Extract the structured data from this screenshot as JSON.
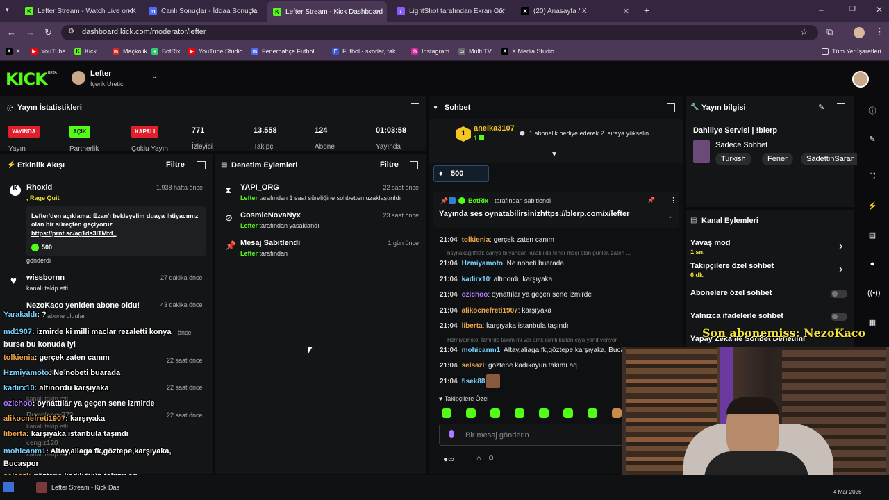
{
  "browser": {
    "tabs": [
      {
        "title": "Lefter Stream - Watch Live on K",
        "icon": "kick-icon",
        "color": "#53fc18",
        "glyph": "K"
      },
      {
        "title": "Canlı Sonuçlar - İddaa Sonuçla",
        "icon": "mackolik-icon",
        "color": "#4a6cf7",
        "glyph": "m"
      },
      {
        "title": "Lefter Stream - Kick Dashboard",
        "icon": "kick-icon",
        "color": "#53fc18",
        "glyph": "K"
      },
      {
        "title": "LightShot tarafından Ekran Gör",
        "icon": "feather-icon",
        "color": "#8a5cf6",
        "glyph": "/"
      },
      {
        "title": "(20) Anasayfa / X",
        "icon": "x-icon",
        "color": "#000000",
        "glyph": "X"
      }
    ],
    "url": "dashboard.kick.com/moderator/lefter",
    "bookmarks": [
      {
        "label": "X",
        "icon": "x-icon",
        "color": "#000000",
        "glyph": "X"
      },
      {
        "label": "YouTube",
        "icon": "youtube-icon",
        "color": "#ff0000",
        "glyph": "▶"
      },
      {
        "label": "Kick",
        "icon": "kick-icon",
        "color": "#53fc18",
        "glyph": "K"
      },
      {
        "label": "Maçkolik",
        "icon": "mackolik-icon",
        "color": "#e2231a",
        "glyph": "m"
      },
      {
        "label": "BotRix",
        "icon": "botrix-icon",
        "color": "#2ecc71",
        "glyph": "●"
      },
      {
        "label": "YouTube Studio",
        "icon": "youtube-studio-icon",
        "color": "#ff0000",
        "glyph": "▶"
      },
      {
        "label": "Fenerbahçe Futbol...",
        "icon": "mackolik-icon",
        "color": "#4a6cf7",
        "glyph": "m"
      },
      {
        "label": "Futbol - skorlar, tak...",
        "icon": "flashscore-icon",
        "color": "#3b5bdb",
        "glyph": "F"
      },
      {
        "label": "Instagram",
        "icon": "instagram-icon",
        "color": "#d6249f",
        "glyph": "◎"
      },
      {
        "label": "Multi TV",
        "icon": "tv-icon",
        "color": "#666666",
        "glyph": "▭"
      },
      {
        "label": "X Media Studio",
        "icon": "x-icon",
        "color": "#000000",
        "glyph": "X"
      }
    ],
    "all_bookmarks": "Tüm Yer İşaretleri"
  },
  "kick": {
    "logo": "KICK",
    "beta": "BETA",
    "user": {
      "name": "Lefter",
      "role": "İçerik Üretici"
    }
  },
  "stats": {
    "title": "Yayın İstatistikleri",
    "statuses": [
      {
        "badge": "YAYINDA",
        "label": "Yayın",
        "bg": "#e0202d",
        "fg": "#ffffff"
      },
      {
        "badge": "AÇIK",
        "label": "Partnerlik",
        "bg": "#53fc18",
        "fg": "#0b0b0d"
      },
      {
        "badge": "KAPALI",
        "label": "Çoklu Yayın",
        "bg": "#e0202d",
        "fg": "#ffffff"
      }
    ],
    "metrics": [
      {
        "value": "771",
        "label": "İzleyici"
      },
      {
        "value": "13.558",
        "label": "Takipçi"
      },
      {
        "value": "124",
        "label": "Abone"
      },
      {
        "value": "01:03:58",
        "label": "Yayında"
      }
    ]
  },
  "activity": {
    "title": "Etkinlik Akışı",
    "filter": "Filtre",
    "items": [
      {
        "user": "Rhoxid",
        "time": "1.938 hafta önce",
        "sub": ", Rage Quit",
        "note": "Lefter'den açıklama: Ezan'ı bekleyelim duaya ihtiyacımız olan bir süreçten geçiyoruz",
        "link": "https://prnt.sc/ag1ds3ITMtd_",
        "amount": "500",
        "action": "gönderdi"
      },
      {
        "user": "wissbornn",
        "time": "27 dakika önce",
        "action": "kanalı takip etti"
      },
      {
        "user": "NezoKaco yeniden abone oldu!",
        "time": "43 dakika önce",
        "action": "abone oldular"
      }
    ],
    "hidden_times": [
      "önce",
      "22 saat önce",
      "22 saat önce",
      "22 saat önce"
    ],
    "hidden_users": [
      "Rumbleboy773",
      "cengiz120"
    ],
    "hidden_actions": [
      "kanalı takip etti",
      "kanalı takip etti",
      "kanalı takip etti",
      "kanalı takip etti"
    ]
  },
  "moderation": {
    "title": "Denetim Eylemleri",
    "filter": "Filtre",
    "items": [
      {
        "user": "YAPI_ORG",
        "time": "22 saat önce",
        "by": "Lefter",
        "desc": " tarafından 1 saat süreliğine sohbetten uzaklaştırıldı",
        "icon": "hourglass-icon"
      },
      {
        "user": "CosmicNovaNyx",
        "time": "23 saat önce",
        "by": "Lefter",
        "desc": " tarafından yasaklandı",
        "icon": "ban-icon"
      },
      {
        "user": "Mesaj Sabitlendi",
        "time": "1 gün önce",
        "by": "Lefter",
        "desc": " tarafından",
        "icon": "pin-icon"
      }
    ]
  },
  "chat": {
    "title": "Sohbet",
    "gift": {
      "user": "anelka3107",
      "rank": "1",
      "count": "1",
      "text": "1 abonelik hediye ederek 2. sıraya yükselin"
    },
    "kicks": "500",
    "pinned": {
      "by": "BotRix",
      "suffix": "tarafından sabitlendi",
      "text": "Yayında ses oynatabilirsiniz.",
      "link": "https://blerp.com/x/lefter"
    },
    "messages": [
      {
        "time": "21:04",
        "user": "tolkienia",
        "color": "#f0a64a",
        "text": "gerçek zaten canım",
        "reply": ""
      },
      {
        "time": "",
        "user": "",
        "color": "",
        "text": "",
        "reply": "hsynakagriffith: sarıyo bi yandan kulaklıkla fener maçı olan günler. zaten ..."
      },
      {
        "time": "21:04",
        "user": "Hzmiyamoto",
        "color": "#7ad1ff",
        "text": "Ne nobeti buarada",
        "reply": ""
      },
      {
        "time": "21:04",
        "user": "kadirx10",
        "color": "#7ad1ff",
        "text": "altınordu karşıyaka",
        "reply": ""
      },
      {
        "time": "21:04",
        "user": "ozichoo",
        "color": "#b07cff",
        "text": "oynattılar ya geçen sene izmirde",
        "reply": ""
      },
      {
        "time": "21:04",
        "user": "alikocnefreti1907",
        "color": "#f0a64a",
        "text": "karşıyaka",
        "reply": ""
      },
      {
        "time": "21:04",
        "user": "liberta",
        "color": "#f0a64a",
        "text": "karşıyaka istanbula taşındı",
        "reply": ""
      },
      {
        "time": "",
        "user": "",
        "color": "",
        "text": "",
        "reply": "Hzmiyamoto: İzmirde takım mi var amk isimli kullanıcıya yanıt veriyor"
      },
      {
        "time": "21:04",
        "user": "mohicanm1",
        "color": "#7ad1ff",
        "text": "Altay,aliaga fk,göztepe,karşıyaka, Buca",
        "reply": ""
      },
      {
        "time": "21:04",
        "user": "selsazi",
        "color": "#f0a64a",
        "text": "göztepe kadıköyün takımı aq",
        "reply": ""
      },
      {
        "time": "21:04",
        "user": "fisek88",
        "color": "#7ad1ff",
        "text": "",
        "reply": ""
      }
    ],
    "followers_only": "Takipçilere Özel",
    "placeholder": "Bir mesaj gönderin",
    "points": "0"
  },
  "stream_info": {
    "title": "Yayın bilgisi",
    "stream_title": "Dahiliye Servisi | !blerp",
    "category": "Sadece Sohbet",
    "tags": [
      "Turkish",
      "Fener",
      "SadettinSaran"
    ]
  },
  "channel_actions": {
    "title": "Kanal Eylemleri",
    "items": [
      {
        "label": "Yavaş mod",
        "value": "1 sn.",
        "type": "arrow"
      },
      {
        "label": "Takipçilere özel sohbet",
        "value": "6 dk.",
        "type": "arrow"
      },
      {
        "label": "Abonelere özel sohbet",
        "value": "",
        "type": "toggle"
      },
      {
        "label": "Yalnızca ifadelerle sohbet",
        "value": "",
        "type": "toggle"
      },
      {
        "label": "Yapay Zeka ile Sohbet Denetimi",
        "value": "",
        "type": "none"
      }
    ]
  },
  "overlay": {
    "last_sub": "Son abonemiss: NezoKaco",
    "chat": [
      {
        "user": "Yarakaldı",
        "text": ": ?",
        "color": "#7ad1ff"
      },
      {
        "user": "md1907",
        "text": ": izmirde ki milli maclar rezaletti konya bursa bu konuda iyi",
        "color": "#7ad1ff"
      },
      {
        "user": "tolkienia",
        "text": ": gerçek zaten canım",
        "color": "#f0a64a"
      },
      {
        "user": "Hzmiyamoto",
        "text": ": Ne nobeti buarada",
        "color": "#7ad1ff"
      },
      {
        "user": "kadirx10",
        "text": ": altınordu karşıyaka",
        "color": "#7ad1ff"
      },
      {
        "user": "ozichoo",
        "text": ": oynattılar ya geçen sene izmirde",
        "color": "#b07cff"
      },
      {
        "user": "alikocnefreti1907",
        "text": ": karşıyaka",
        "color": "#f0a64a"
      },
      {
        "user": "liberta",
        "text": ": karşıyaka istanbula taşındı",
        "color": "#f0a64a"
      },
      {
        "user": "mohicanm1",
        "text": ": Altay,aliaga fk,göztepe,karşıyaka, Bucaspor",
        "color": "#7ad1ff"
      },
      {
        "user": "selsazi",
        "text": ": göztepe kadıköyün takımı aq",
        "color": "#f0a64a"
      },
      {
        "user": "fisek88",
        "text": ":",
        "color": "#7ad1ff"
      }
    ]
  },
  "taskbar": {
    "item": "Lefter Stream - Kick Das",
    "date": "4 Mar 2026"
  }
}
